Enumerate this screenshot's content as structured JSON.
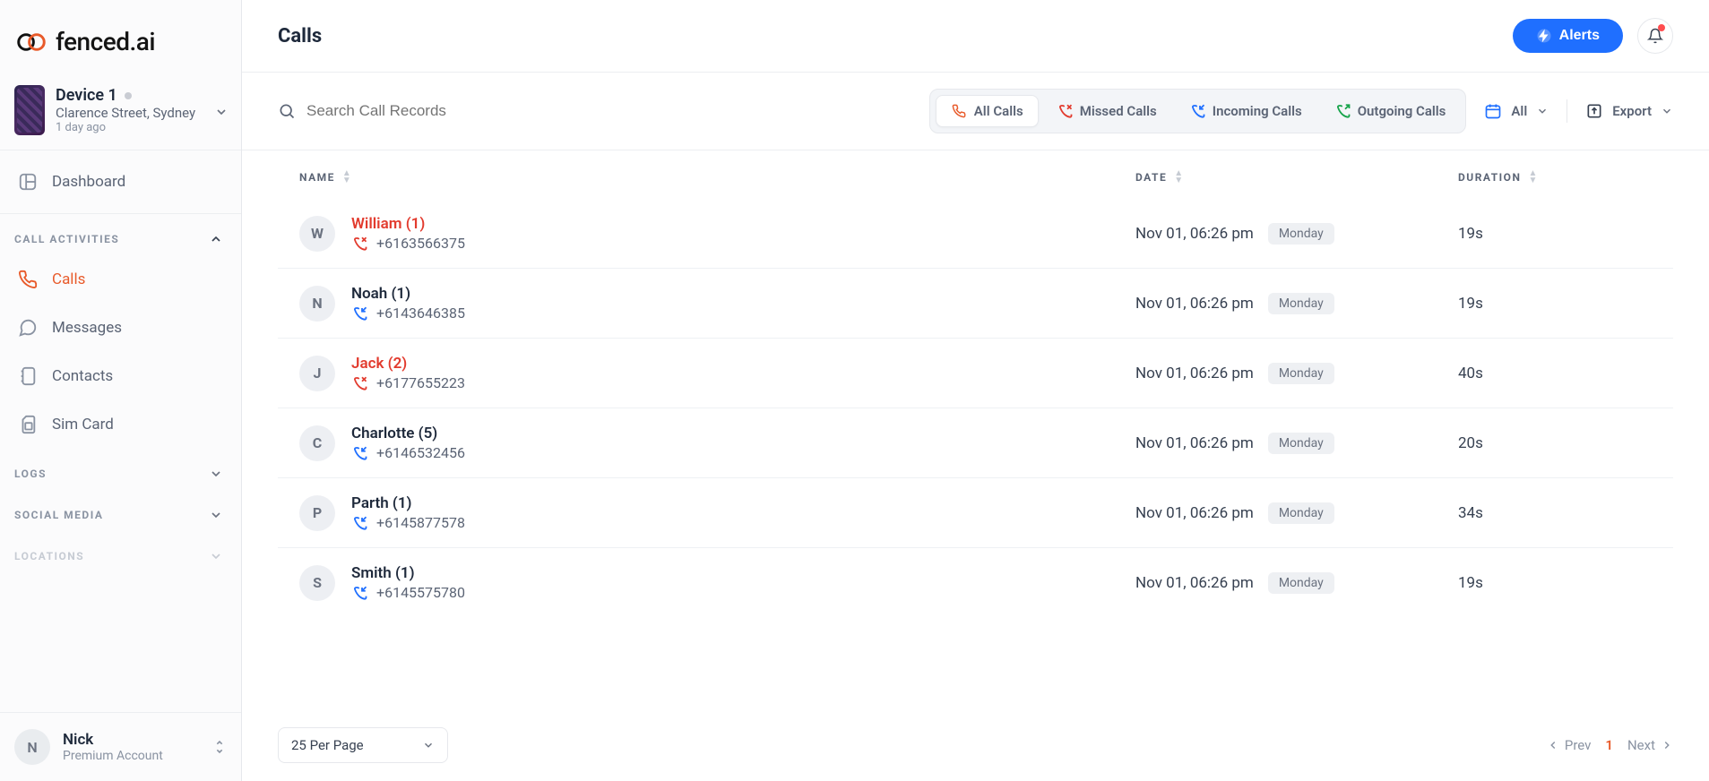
{
  "brand": {
    "name": "fenced.ai"
  },
  "device": {
    "name": "Device 1",
    "location": "Clarence Street, Sydney",
    "lastSeen": "1 day ago"
  },
  "sidebar": {
    "dashboard": "Dashboard",
    "groups": {
      "callActivities": {
        "title": "CALL ACTIVITIES",
        "items": {
          "calls": "Calls",
          "messages": "Messages",
          "contacts": "Contacts",
          "simCard": "Sim Card"
        }
      },
      "logs": {
        "title": "LOGS"
      },
      "socialMedia": {
        "title": "SOCIAL MEDIA"
      },
      "locations": {
        "title": "LOCATIONS"
      }
    }
  },
  "user": {
    "initial": "N",
    "name": "Nick",
    "plan": "Premium Account"
  },
  "page": {
    "title": "Calls",
    "alerts": "Alerts"
  },
  "search": {
    "placeholder": "Search Call Records"
  },
  "tabs": {
    "all": "All Calls",
    "missed": "Missed Calls",
    "incoming": "Incoming Calls",
    "outgoing": "Outgoing Calls"
  },
  "dateRange": {
    "label": "All"
  },
  "export": {
    "label": "Export"
  },
  "table": {
    "headers": {
      "name": "NAME",
      "date": "DATE",
      "duration": "DURATION"
    },
    "rows": [
      {
        "initial": "W",
        "name": "William (1)",
        "type": "missed",
        "phone": "+6163566375",
        "date": "Nov 01, 06:26 pm",
        "day": "Monday",
        "duration": "19s"
      },
      {
        "initial": "N",
        "name": "Noah (1)",
        "type": "incoming",
        "phone": "+6143646385",
        "date": "Nov 01, 06:26 pm",
        "day": "Monday",
        "duration": "19s"
      },
      {
        "initial": "J",
        "name": "Jack (2)",
        "type": "missed",
        "phone": "+6177655223",
        "date": "Nov 01, 06:26 pm",
        "day": "Monday",
        "duration": "40s"
      },
      {
        "initial": "C",
        "name": "Charlotte (5)",
        "type": "incoming",
        "phone": "+6146532456",
        "date": "Nov 01, 06:26 pm",
        "day": "Monday",
        "duration": "20s"
      },
      {
        "initial": "P",
        "name": "Parth (1)",
        "type": "incoming",
        "phone": "+6145877578",
        "date": "Nov 01, 06:26 pm",
        "day": "Monday",
        "duration": "34s"
      },
      {
        "initial": "S",
        "name": "Smith (1)",
        "type": "incoming",
        "phone": "+6145575780",
        "date": "Nov 01, 06:26 pm",
        "day": "Monday",
        "duration": "19s"
      }
    ]
  },
  "pagination": {
    "perPage": "25 Per Page",
    "prev": "Prev",
    "next": "Next",
    "current": "1"
  }
}
